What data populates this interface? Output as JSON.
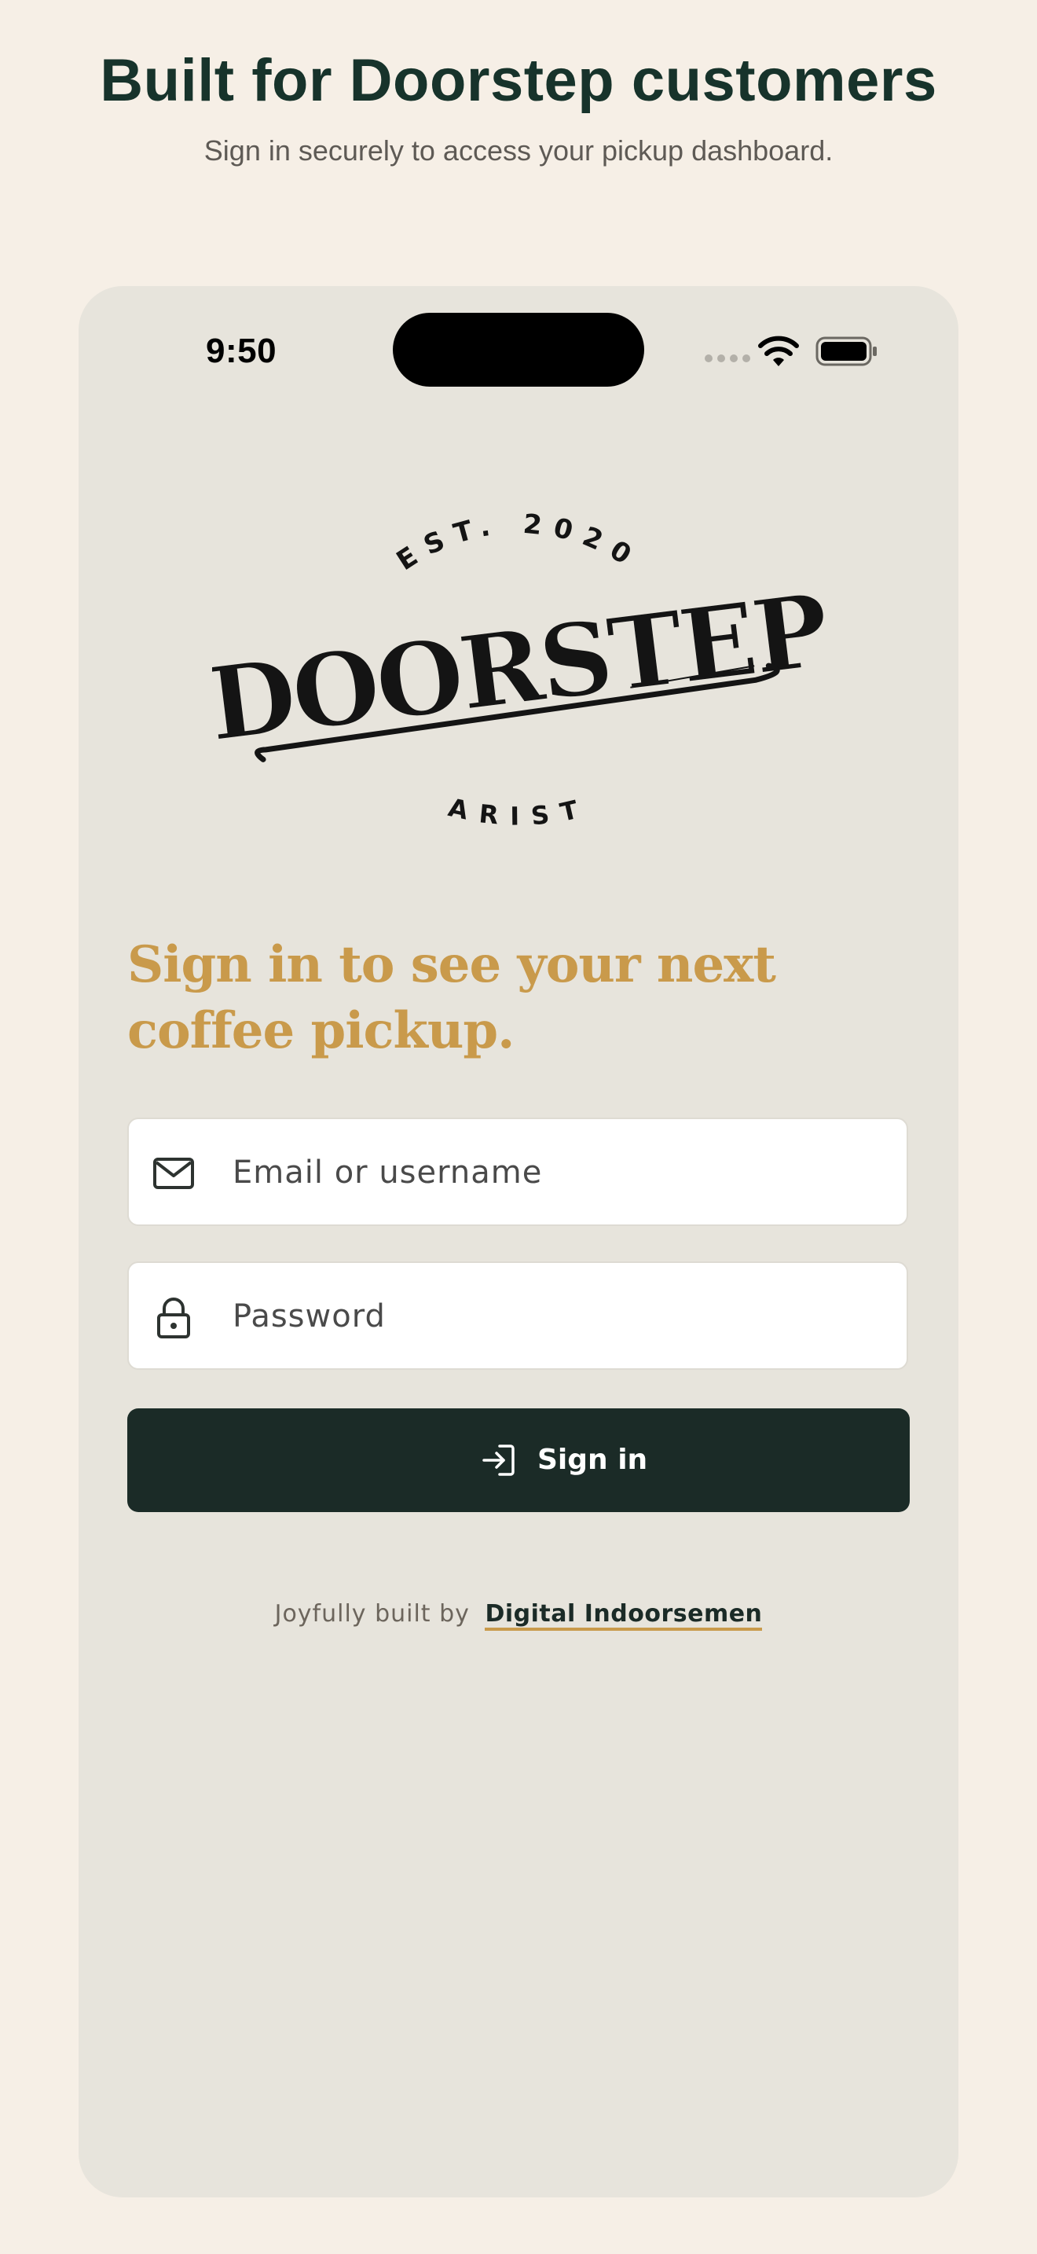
{
  "page": {
    "title": "Built for Doorstep customers",
    "subtitle": "Sign in securely to access your pickup dashboard."
  },
  "status_bar": {
    "time": "9:50",
    "icons": [
      "signal-icon",
      "wifi-icon",
      "battery-icon"
    ]
  },
  "logo": {
    "top_text": "EST. 2020",
    "brand": "DOORSTEP",
    "bottom_text": "BARISTA",
    "icon": "doorstep-logo"
  },
  "login": {
    "headline": "Sign in to see your next coffee pickup.",
    "email_placeholder": "Email or username",
    "email_value": "",
    "password_placeholder": "Password",
    "password_value": "",
    "email_icon": "mail-icon",
    "password_icon": "lock-icon",
    "signin_label": "Sign in",
    "signin_icon": "sign-in-icon"
  },
  "footer": {
    "prefix": "Joyfully built by",
    "link_text": "Digital Indoorsemen"
  },
  "colors": {
    "page_background": "#f6efe6",
    "phone_background": "#e7e4dc",
    "title": "#17332b",
    "accent_gold": "#c99a4b",
    "button": "#1b2b27"
  }
}
